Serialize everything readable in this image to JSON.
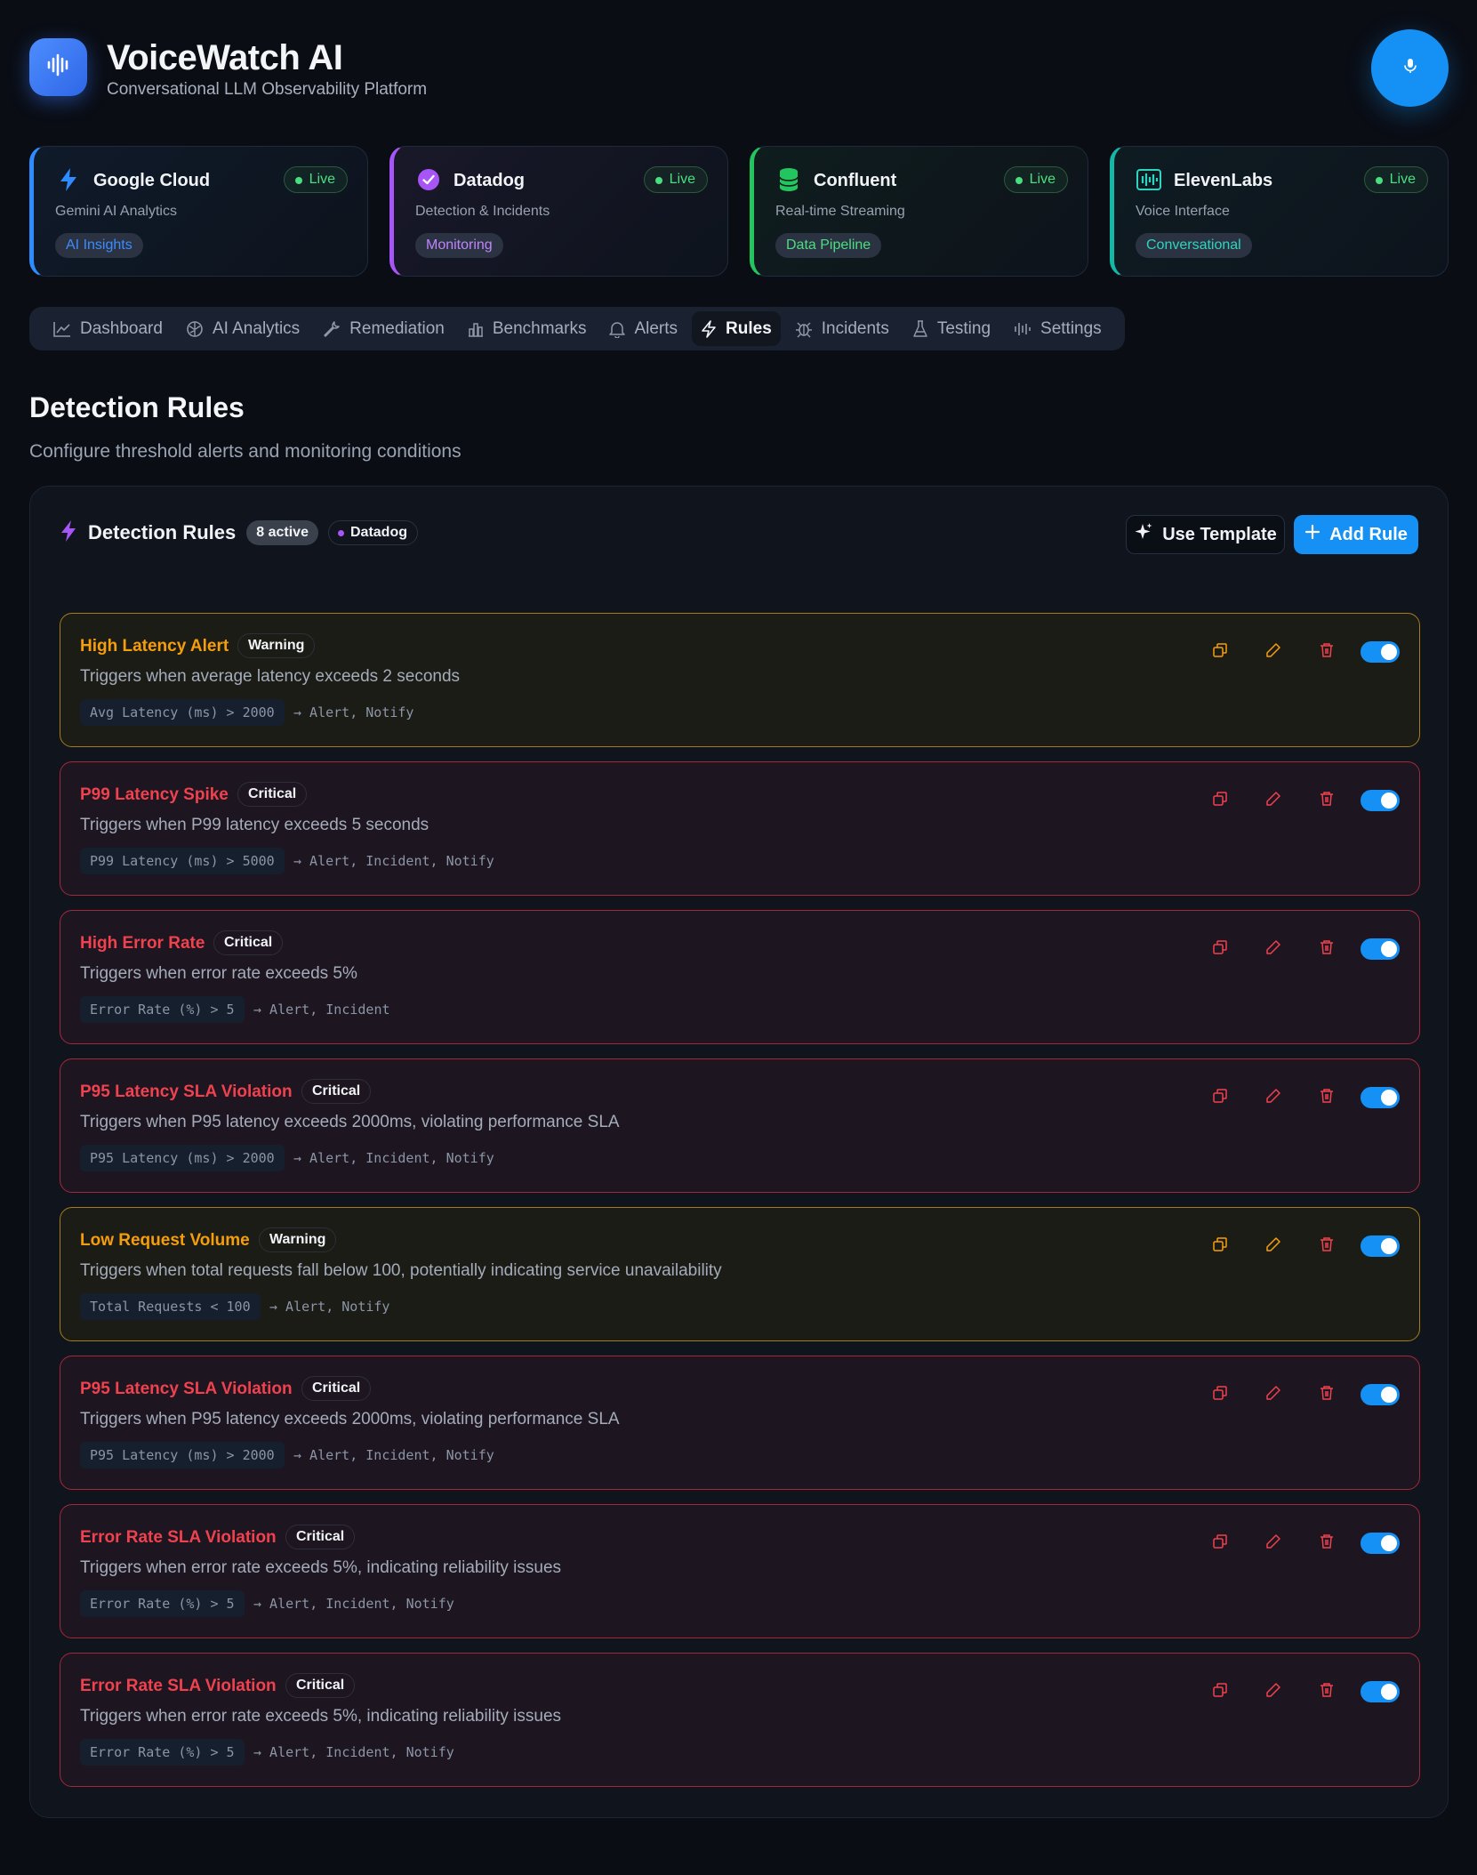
{
  "app": {
    "title": "VoiceWatch AI",
    "subtitle": "Conversational LLM Observability Platform",
    "logo_icon": "waveform-icon",
    "mic_icon": "microphone-icon"
  },
  "integrations": [
    {
      "name": "Google Cloud",
      "desc": "Gemini AI Analytics",
      "pill": "AI Insights",
      "status": "Live",
      "icon": "lightning-icon",
      "accent": "#2f8cff",
      "pill_color": "#3b8cff",
      "bg": "#0f1a2a"
    },
    {
      "name": "Datadog",
      "desc": "Detection & Incidents",
      "pill": "Monitoring",
      "status": "Live",
      "icon": "check-circle-icon",
      "accent": "#a855f7",
      "pill_color": "#c084fc",
      "bg": "#191829"
    },
    {
      "name": "Confluent",
      "desc": "Real-time Streaming",
      "pill": "Data Pipeline",
      "status": "Live",
      "icon": "database-icon",
      "accent": "#22c55e",
      "pill_color": "#4ade80",
      "bg": "#0f1d1d"
    },
    {
      "name": "ElevenLabs",
      "desc": "Voice Interface",
      "pill": "Conversational",
      "status": "Live",
      "icon": "audio-bars-icon",
      "accent": "#14b8a6",
      "pill_color": "#2dd4bf",
      "bg": "#0e1c22"
    }
  ],
  "nav": [
    {
      "label": "Dashboard",
      "icon": "chart-line-icon"
    },
    {
      "label": "AI Analytics",
      "icon": "brain-icon"
    },
    {
      "label": "Remediation",
      "icon": "wrench-icon"
    },
    {
      "label": "Benchmarks",
      "icon": "bar-chart-icon"
    },
    {
      "label": "Alerts",
      "icon": "bell-icon"
    },
    {
      "label": "Rules",
      "icon": "lightning-icon",
      "active": true
    },
    {
      "label": "Incidents",
      "icon": "bug-icon"
    },
    {
      "label": "Testing",
      "icon": "flask-icon"
    },
    {
      "label": "Settings",
      "icon": "audio-bars-icon"
    }
  ],
  "page": {
    "title": "Detection Rules",
    "subtitle": "Configure threshold alerts and monitoring conditions"
  },
  "panel": {
    "title": "Detection Rules",
    "count": "8 active",
    "source": "Datadog",
    "template_label": "Use Template",
    "add_label": "Add Rule"
  },
  "rules": [
    {
      "name": "High Latency Alert",
      "severity": "Warning",
      "desc": "Triggers when average latency exceeds 2 seconds",
      "condition": "Avg Latency (ms) > 2000",
      "actions": "→ Alert, Notify",
      "enabled": true
    },
    {
      "name": "P99 Latency Spike",
      "severity": "Critical",
      "desc": "Triggers when P99 latency exceeds 5 seconds",
      "condition": "P99 Latency (ms) > 5000",
      "actions": "→ Alert, Incident, Notify",
      "enabled": true
    },
    {
      "name": "High Error Rate",
      "severity": "Critical",
      "desc": "Triggers when error rate exceeds 5%",
      "condition": "Error Rate (%) > 5",
      "actions": "→ Alert, Incident",
      "enabled": true
    },
    {
      "name": "P95 Latency SLA Violation",
      "severity": "Critical",
      "desc": "Triggers when P95 latency exceeds 2000ms, violating performance SLA",
      "condition": "P95 Latency (ms) > 2000",
      "actions": "→ Alert, Incident, Notify",
      "enabled": true
    },
    {
      "name": "Low Request Volume",
      "severity": "Warning",
      "desc": "Triggers when total requests fall below 100, potentially indicating service unavailability",
      "condition": "Total Requests < 100",
      "actions": "→ Alert, Notify",
      "enabled": true
    },
    {
      "name": "P95 Latency SLA Violation",
      "severity": "Critical",
      "desc": "Triggers when P95 latency exceeds 2000ms, violating performance SLA",
      "condition": "P95 Latency (ms) > 2000",
      "actions": "→ Alert, Incident, Notify",
      "enabled": true
    },
    {
      "name": "Error Rate SLA Violation",
      "severity": "Critical",
      "desc": "Triggers when error rate exceeds 5%, indicating reliability issues",
      "condition": "Error Rate (%) > 5",
      "actions": "→ Alert, Incident, Notify",
      "enabled": true
    },
    {
      "name": "Error Rate SLA Violation",
      "severity": "Critical",
      "desc": "Triggers when error rate exceeds 5%, indicating reliability issues",
      "condition": "Error Rate (%) > 5",
      "actions": "→ Alert, Incident, Notify",
      "enabled": true
    }
  ],
  "colors": {
    "warning": "#f59e0b",
    "critical": "#f0414f",
    "primary": "#1591f5"
  }
}
